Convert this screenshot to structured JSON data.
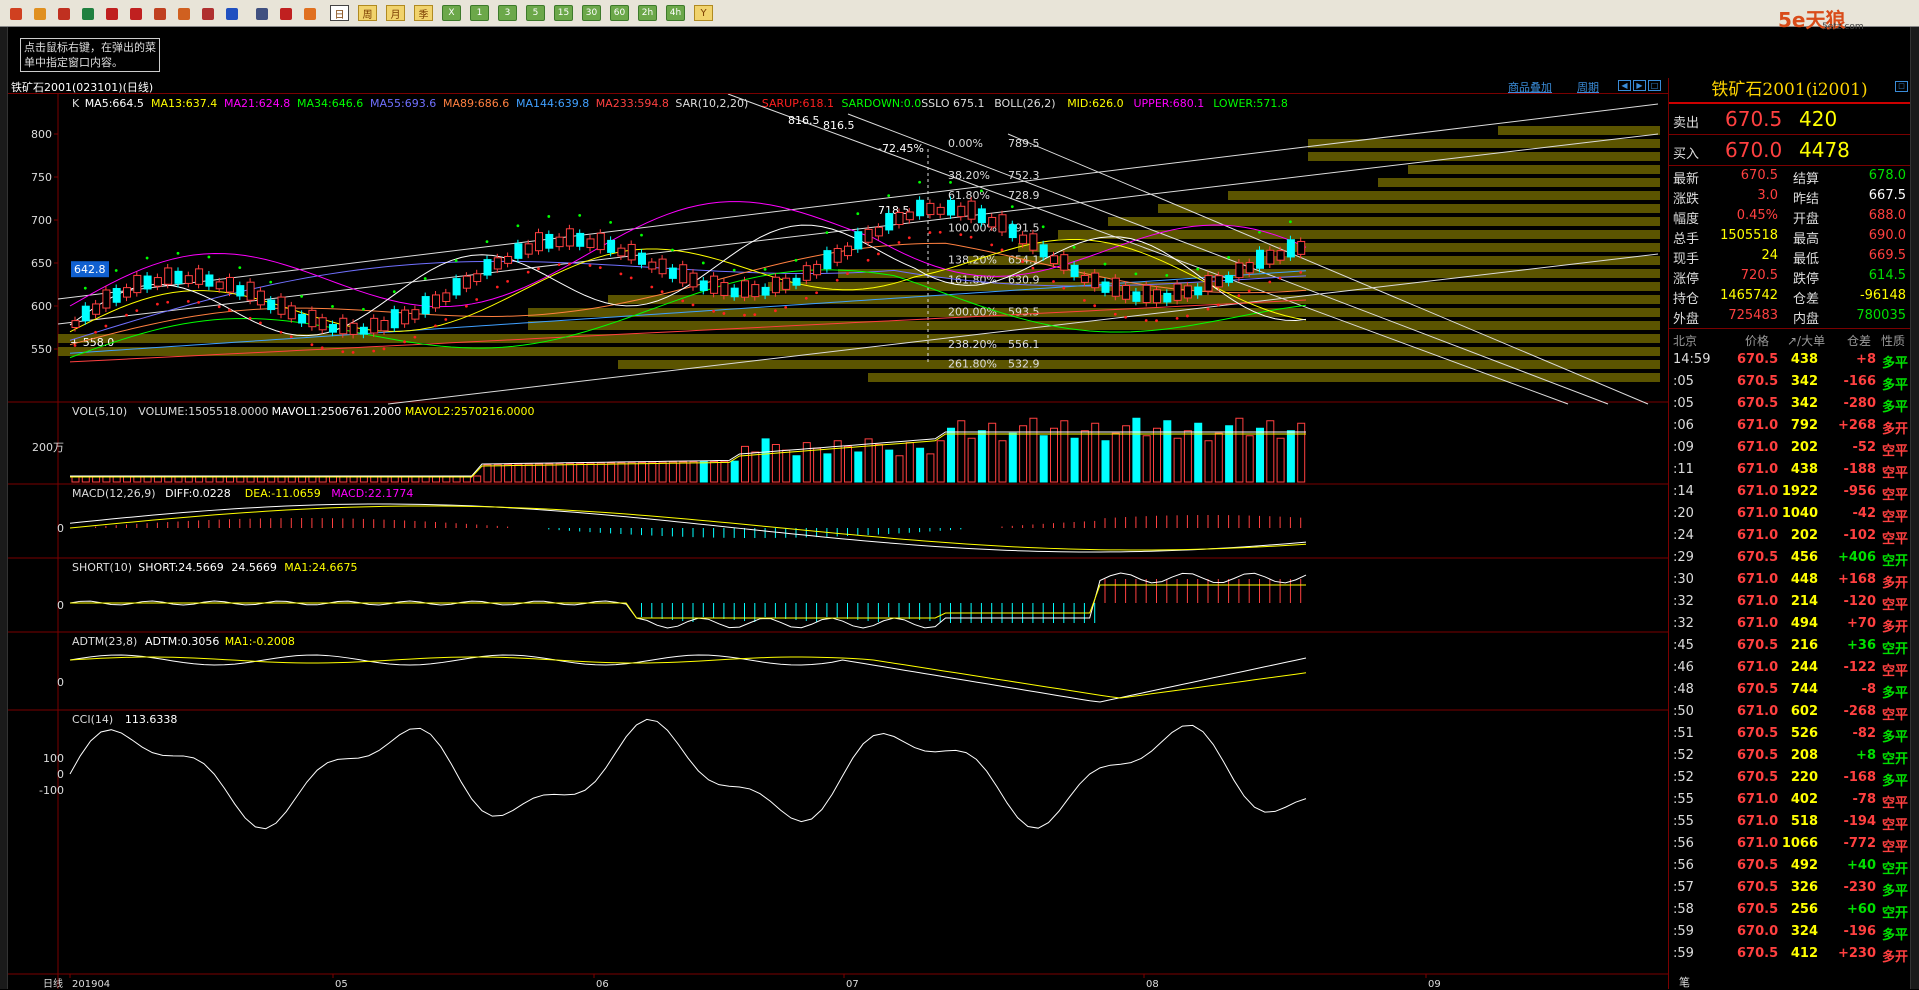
{
  "toolbar": {
    "buttons": [
      "首页",
      "资讯",
      "报价",
      "刷新",
      "放大",
      "缩小",
      "画线",
      "标注",
      "工具",
      "新闻",
      "列表",
      "走势",
      "K线",
      "日",
      "周",
      "月",
      "季",
      "X",
      "1",
      "3",
      "5",
      "15",
      "30",
      "60",
      "2h",
      "4h",
      "Y"
    ],
    "selected": "日"
  },
  "logo": {
    "text": "5e天狼",
    "sub": "5etz.com"
  },
  "tip": "点击鼠标右键，在弹出的菜单中指定窗口内容。",
  "chart_title": "铁矿石2001(023101)(日线)",
  "links": {
    "product_add": "商品叠加",
    "period": "周期"
  },
  "current_price_tag": "642.8",
  "main_indicators": [
    {
      "t": "K",
      "c": "#dddddd"
    },
    {
      "t": "MA5:664.5",
      "c": "#ffffff"
    },
    {
      "t": "MA13:637.4",
      "c": "#ffff00"
    },
    {
      "t": "MA21:624.8",
      "c": "#ff00ff"
    },
    {
      "t": "MA34:646.6",
      "c": "#00ff00"
    },
    {
      "t": "MA55:693.6",
      "c": "#7070ff"
    },
    {
      "t": "MA89:686.6",
      "c": "#ff8040"
    },
    {
      "t": "MA144:639.8",
      "c": "#40a0ff"
    },
    {
      "t": "MA233:594.8",
      "c": "#ff4040"
    },
    {
      "t": "SAR(10,2,20)",
      "c": "#dddddd"
    },
    {
      "t": "SARUP:618.1",
      "c": "#ff2020"
    },
    {
      "t": "SARDOWN:0.0",
      "c": "#00ff00"
    },
    {
      "t": "SSLO 675.1",
      "c": "#dddddd"
    },
    {
      "t": "BOLL(26,2)",
      "c": "#dddddd"
    },
    {
      "t": "MID:626.0",
      "c": "#ffff00"
    },
    {
      "t": "UPPER:680.1",
      "c": "#ff00ff"
    },
    {
      "t": "LOWER:571.8",
      "c": "#00ff00"
    }
  ],
  "price_axis": [
    "800",
    "750",
    "700",
    "650",
    "600",
    "550"
  ],
  "annotations": {
    "high1": "816.5",
    "high2": "816.5",
    "low1": "718.5",
    "low2": "558.0",
    "pct": "-72.45%"
  },
  "fib_levels": [
    {
      "pct": "0.00%",
      "val": "789.5"
    },
    {
      "pct": "38.20%",
      "val": "752.3"
    },
    {
      "pct": "61.80%",
      "val": "728.9"
    },
    {
      "pct": "100.00%",
      "val": "691.5"
    },
    {
      "pct": "138.20%",
      "val": "654.1"
    },
    {
      "pct": "161.80%",
      "val": "630.9"
    },
    {
      "pct": "200.00%",
      "val": "593.5"
    },
    {
      "pct": "238.20%",
      "val": "556.1"
    },
    {
      "pct": "261.80%",
      "val": "532.9"
    }
  ],
  "vol_panel": {
    "items": [
      {
        "t": "VOL(5,10)",
        "c": "#dddddd"
      },
      {
        "t": "VOLUME:1505518.0000",
        "c": "#dddddd"
      },
      {
        "t": "MAVOL1:2506761.2000",
        "c": "#ffffff"
      },
      {
        "t": "MAVOL2:2570216.0000",
        "c": "#ffff00"
      }
    ],
    "axis": "200万"
  },
  "macd_panel": {
    "items": [
      {
        "t": "MACD(12,26,9)",
        "c": "#dddddd"
      },
      {
        "t": "DIFF:0.0228",
        "c": "#ffffff"
      },
      {
        "t": "DEA:-11.0659",
        "c": "#ffff00"
      },
      {
        "t": "MACD:22.1774",
        "c": "#ff00ff"
      }
    ],
    "axis": "0"
  },
  "short_panel": {
    "items": [
      {
        "t": "SHORT(10)",
        "c": "#dddddd"
      },
      {
        "t": "SHORT:24.5669",
        "c": "#ffffff"
      },
      {
        "t": "24.5669",
        "c": "#ffffff"
      },
      {
        "t": "MA1:24.6675",
        "c": "#ffff00"
      }
    ],
    "axis": "0"
  },
  "adtm_panel": {
    "items": [
      {
        "t": "ADTM(23,8)",
        "c": "#dddddd"
      },
      {
        "t": "ADTM:0.3056",
        "c": "#ffffff"
      },
      {
        "t": "MA1:-0.2008",
        "c": "#ffff00"
      }
    ],
    "axis": "0"
  },
  "cci_panel": {
    "items": [
      {
        "t": "CCI(14)",
        "c": "#dddddd"
      },
      {
        "t": "113.6338",
        "c": "#ffffff"
      }
    ],
    "axis": [
      "100",
      "0",
      "-100"
    ]
  },
  "date_axis": {
    "label": "日线",
    "ticks": [
      "201904",
      "05",
      "06",
      "07",
      "08",
      "09"
    ]
  },
  "quote": {
    "title": "铁矿石2001(i2001)",
    "sell": {
      "label": "卖出",
      "price": "670.5",
      "vol": "420"
    },
    "buy": {
      "label": "买入",
      "price": "670.0",
      "vol": "4478"
    },
    "stats": [
      {
        "k1": "最新",
        "v1": "670.5",
        "c1": "red",
        "k2": "结算",
        "v2": "678.0",
        "c2": "green"
      },
      {
        "k1": "涨跌",
        "v1": "3.0",
        "c1": "red",
        "k2": "昨结",
        "v2": "667.5",
        "c2": "white"
      },
      {
        "k1": "幅度",
        "v1": "0.45%",
        "c1": "red",
        "k2": "开盘",
        "v2": "688.0",
        "c2": "red"
      },
      {
        "k1": "总手",
        "v1": "1505518",
        "c1": "yellow",
        "k2": "最高",
        "v2": "690.0",
        "c2": "red"
      },
      {
        "k1": "现手",
        "v1": "24",
        "c1": "yellow",
        "k2": "最低",
        "v2": "669.5",
        "c2": "red"
      },
      {
        "k1": "涨停",
        "v1": "720.5",
        "c1": "red",
        "k2": "跌停",
        "v2": "614.5",
        "c2": "green"
      },
      {
        "k1": "持仓",
        "v1": "1465742",
        "c1": "yellow",
        "k2": "仓差",
        "v2": "-96148",
        "c2": "yellow"
      },
      {
        "k1": "外盘",
        "v1": "725483",
        "c1": "red",
        "k2": "内盘",
        "v2": "780035",
        "c2": "green"
      }
    ],
    "tick_header": {
      "time": "北京",
      "price": "价格",
      "vol": "↗/大单",
      "oi": "仓差",
      "nature": "性质"
    },
    "ticks": [
      {
        "t": "14:59",
        "p": "670.5",
        "v": "438",
        "o": "+8",
        "n": "多平",
        "pc": "red",
        "oc": "red",
        "nc": "green"
      },
      {
        "t": ":05",
        "p": "670.5",
        "v": "342",
        "o": "-166",
        "n": "多平",
        "pc": "red",
        "oc": "red",
        "nc": "green"
      },
      {
        "t": ":05",
        "p": "670.5",
        "v": "342",
        "o": "-280",
        "n": "多平",
        "pc": "red",
        "oc": "red",
        "nc": "green"
      },
      {
        "t": ":06",
        "p": "671.0",
        "v": "792",
        "o": "+268",
        "n": "多开",
        "pc": "red",
        "oc": "red",
        "nc": "red"
      },
      {
        "t": ":09",
        "p": "671.0",
        "v": "202",
        "o": "-52",
        "n": "空平",
        "pc": "red",
        "oc": "red",
        "nc": "red"
      },
      {
        "t": ":11",
        "p": "671.0",
        "v": "438",
        "o": "-188",
        "n": "空平",
        "pc": "red",
        "oc": "red",
        "nc": "red"
      },
      {
        "t": ":14",
        "p": "671.0",
        "v": "1922",
        "o": "-956",
        "n": "空平",
        "pc": "red",
        "oc": "red",
        "nc": "red"
      },
      {
        "t": ":20",
        "p": "671.0",
        "v": "1040",
        "o": "-42",
        "n": "空平",
        "pc": "red",
        "oc": "red",
        "nc": "red"
      },
      {
        "t": ":24",
        "p": "671.0",
        "v": "202",
        "o": "-102",
        "n": "空平",
        "pc": "red",
        "oc": "red",
        "nc": "red"
      },
      {
        "t": ":29",
        "p": "670.5",
        "v": "456",
        "o": "+406",
        "n": "空开",
        "pc": "red",
        "oc": "green",
        "nc": "green"
      },
      {
        "t": ":30",
        "p": "671.0",
        "v": "448",
        "o": "+168",
        "n": "多开",
        "pc": "red",
        "oc": "red",
        "nc": "red"
      },
      {
        "t": ":32",
        "p": "671.0",
        "v": "214",
        "o": "-120",
        "n": "空平",
        "pc": "red",
        "oc": "red",
        "nc": "red"
      },
      {
        "t": ":32",
        "p": "671.0",
        "v": "494",
        "o": "+70",
        "n": "多开",
        "pc": "red",
        "oc": "red",
        "nc": "red"
      },
      {
        "t": ":45",
        "p": "670.5",
        "v": "216",
        "o": "+36",
        "n": "空开",
        "pc": "red",
        "oc": "green",
        "nc": "green"
      },
      {
        "t": ":46",
        "p": "671.0",
        "v": "244",
        "o": "-122",
        "n": "空平",
        "pc": "red",
        "oc": "red",
        "nc": "red"
      },
      {
        "t": ":48",
        "p": "670.5",
        "v": "744",
        "o": "-8",
        "n": "多平",
        "pc": "red",
        "oc": "red",
        "nc": "green"
      },
      {
        "t": ":50",
        "p": "671.0",
        "v": "602",
        "o": "-268",
        "n": "空平",
        "pc": "red",
        "oc": "red",
        "nc": "red"
      },
      {
        "t": ":51",
        "p": "670.5",
        "v": "526",
        "o": "-82",
        "n": "多平",
        "pc": "red",
        "oc": "red",
        "nc": "green"
      },
      {
        "t": ":52",
        "p": "670.5",
        "v": "208",
        "o": "+8",
        "n": "空开",
        "pc": "red",
        "oc": "green",
        "nc": "green"
      },
      {
        "t": ":52",
        "p": "670.5",
        "v": "220",
        "o": "-168",
        "n": "多平",
        "pc": "red",
        "oc": "red",
        "nc": "green"
      },
      {
        "t": ":55",
        "p": "671.0",
        "v": "402",
        "o": "-78",
        "n": "空平",
        "pc": "red",
        "oc": "red",
        "nc": "red"
      },
      {
        "t": ":55",
        "p": "671.0",
        "v": "518",
        "o": "-194",
        "n": "空平",
        "pc": "red",
        "oc": "red",
        "nc": "red"
      },
      {
        "t": ":56",
        "p": "671.0",
        "v": "1066",
        "o": "-772",
        "n": "空平",
        "pc": "red",
        "oc": "red",
        "nc": "red"
      },
      {
        "t": ":56",
        "p": "670.5",
        "v": "492",
        "o": "+40",
        "n": "空开",
        "pc": "red",
        "oc": "green",
        "nc": "green"
      },
      {
        "t": ":57",
        "p": "670.5",
        "v": "326",
        "o": "-230",
        "n": "多平",
        "pc": "red",
        "oc": "red",
        "nc": "green"
      },
      {
        "t": ":58",
        "p": "670.5",
        "v": "256",
        "o": "+60",
        "n": "空开",
        "pc": "red",
        "oc": "green",
        "nc": "green"
      },
      {
        "t": ":59",
        "p": "670.0",
        "v": "324",
        "o": "-196",
        "n": "多平",
        "pc": "red",
        "oc": "red",
        "nc": "green"
      },
      {
        "t": ":59",
        "p": "670.5",
        "v": "412",
        "o": "+230",
        "n": "多开",
        "pc": "red",
        "oc": "red",
        "nc": "red"
      }
    ],
    "footer": "笔"
  }
}
